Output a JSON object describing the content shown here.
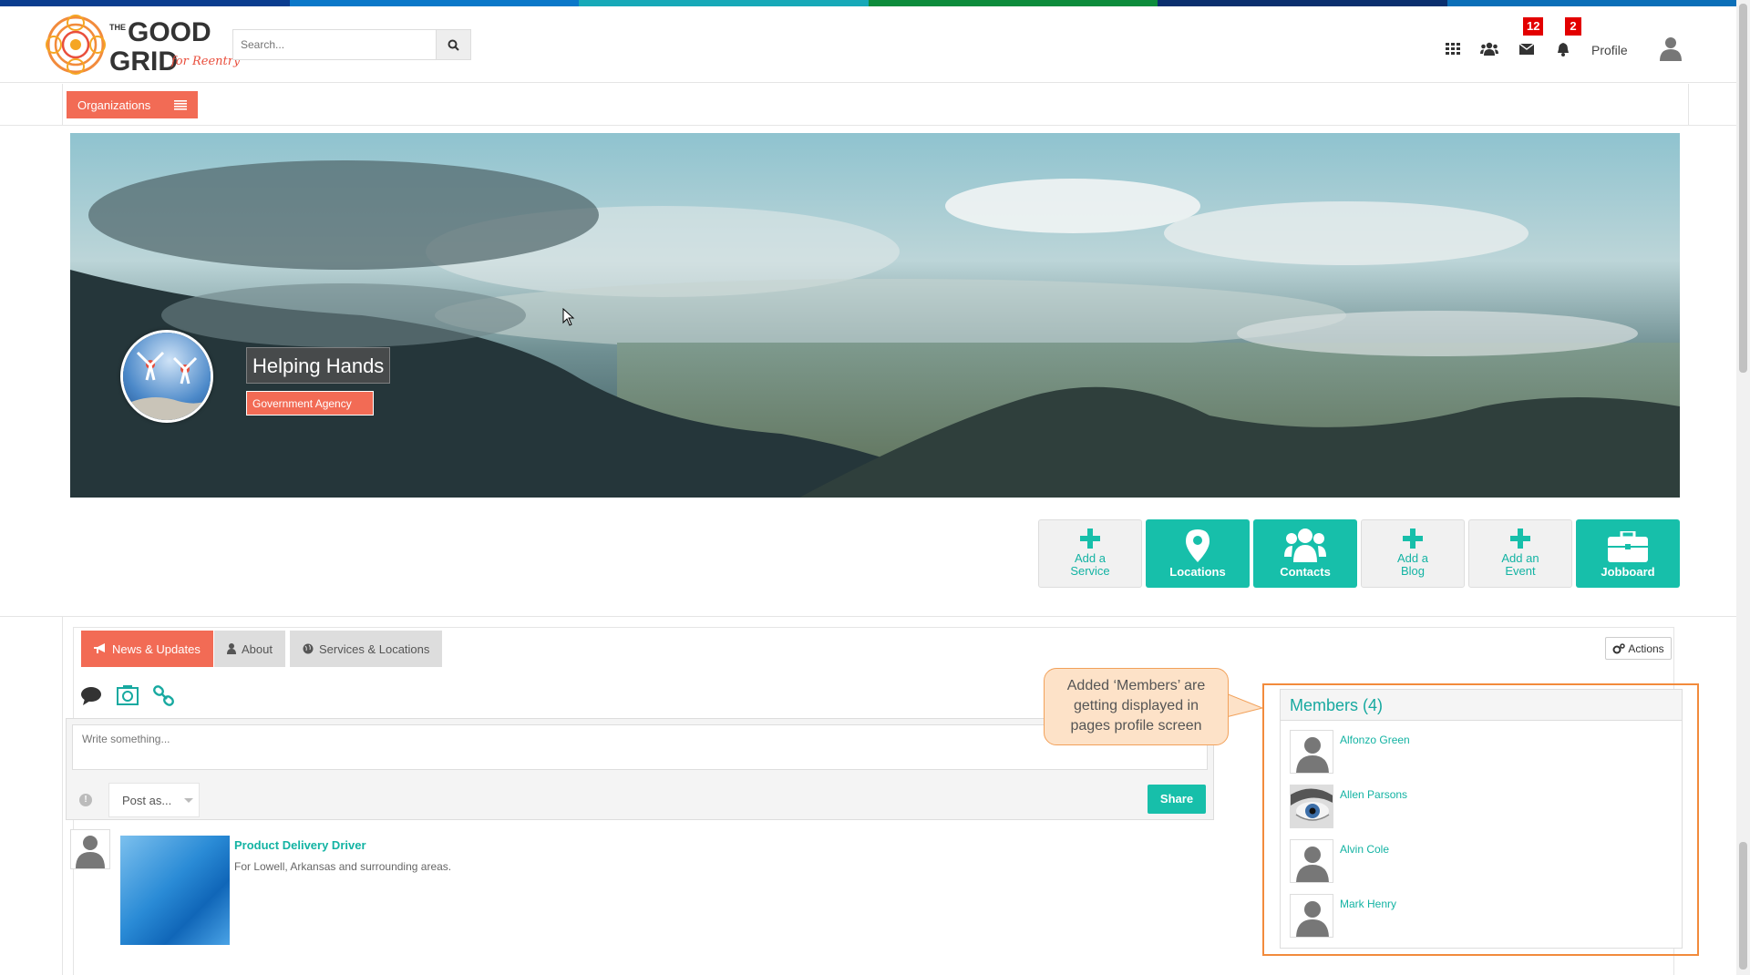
{
  "colors": {
    "stripe": [
      "#0a3d8f",
      "#0b78c9",
      "#17a9b8",
      "#0d8c3c",
      "#0a2f6e",
      "#0b6fb8"
    ],
    "accent_orange": "#f26b55",
    "accent_teal": "#17bfaa",
    "callout_border": "#f28b3c"
  },
  "header": {
    "logo_text_top": "GOOD",
    "logo_text_the": "THE",
    "logo_text_bottom": "GRID",
    "logo_tagline": "for Reentry",
    "search_placeholder": "Search...",
    "icons": [
      "apps-grid-icon",
      "users-icon",
      "envelope-icon",
      "bell-icon"
    ],
    "messages_badge": "12",
    "notifications_badge": "2",
    "profile_label": "Profile"
  },
  "subbar": {
    "organizations_label": "Organizations"
  },
  "banner": {
    "org_name": "Helping Hands",
    "org_type": "Government Agency"
  },
  "tiles": [
    {
      "label_line1": "Add a",
      "label_line2": "Service",
      "style": "light",
      "icon": "plus-icon"
    },
    {
      "label_line1": "Locations",
      "label_line2": "",
      "style": "teal",
      "icon": "map-marker-icon"
    },
    {
      "label_line1": "Contacts",
      "label_line2": "",
      "style": "teal",
      "icon": "users-icon"
    },
    {
      "label_line1": "Add a",
      "label_line2": "Blog",
      "style": "light",
      "icon": "plus-icon"
    },
    {
      "label_line1": "Add an",
      "label_line2": "Event",
      "style": "light",
      "icon": "plus-icon"
    },
    {
      "label_line1": "Jobboard",
      "label_line2": "",
      "style": "teal",
      "icon": "briefcase-icon"
    }
  ],
  "tabs": [
    {
      "label": "News & Updates",
      "icon": "bullhorn-icon",
      "active": true
    },
    {
      "label": "About",
      "icon": "user-icon",
      "active": false
    },
    {
      "label": "Services & Locations",
      "icon": "globe-icon",
      "active": false
    }
  ],
  "actions_label": "Actions",
  "composer": {
    "placeholder": "Write something...",
    "post_as_label": "Post as...",
    "share_label": "Share",
    "post_type_icons": [
      "comment-icon",
      "photo-icon",
      "link-icon"
    ]
  },
  "feed": [
    {
      "title": "Product Delivery Driver",
      "description": "For Lowell, Arkansas and surrounding areas."
    }
  ],
  "callout": {
    "line1": "Added ‘Members’ are",
    "line2": "getting displayed in",
    "line3": "pages profile screen"
  },
  "members": {
    "title": "Members (4)",
    "list": [
      {
        "name": "Alfonzo Green",
        "avatar": "default-person"
      },
      {
        "name": "Allen Parsons",
        "avatar": "eye-photo"
      },
      {
        "name": "Alvin Cole",
        "avatar": "default-person"
      },
      {
        "name": "Mark Henry",
        "avatar": "default-person"
      }
    ]
  }
}
